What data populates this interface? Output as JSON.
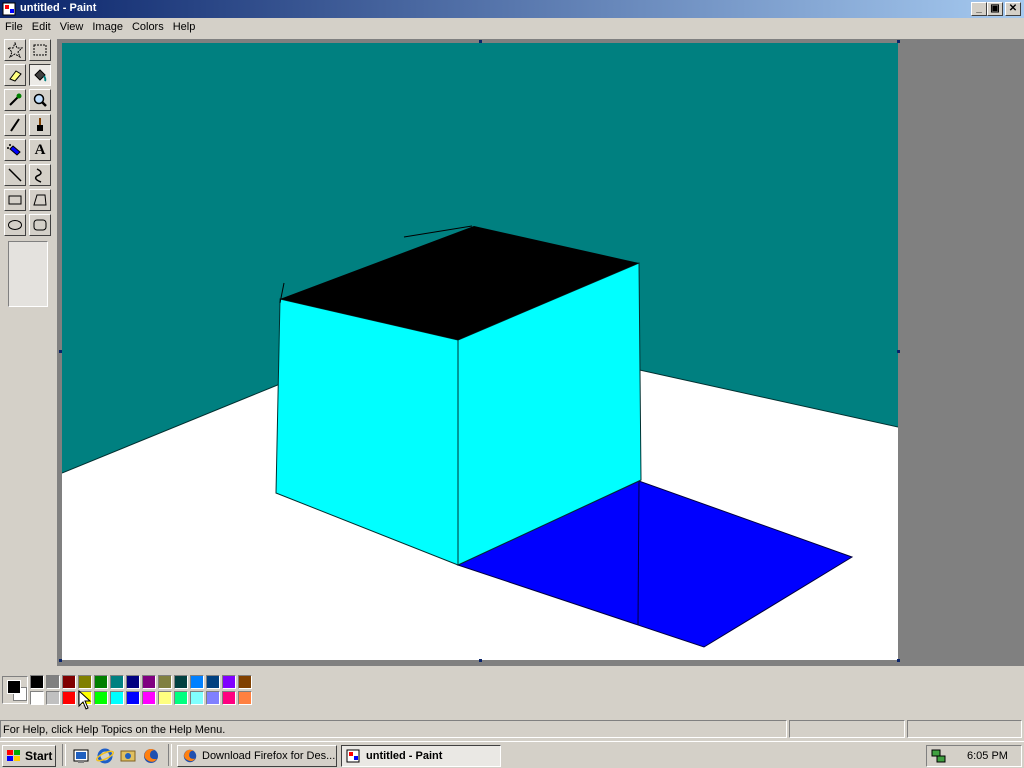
{
  "window": {
    "title": "untitled - Paint",
    "controls": {
      "minimize": "_",
      "maximize": "▣",
      "close": "✕"
    }
  },
  "menubar": {
    "items": [
      {
        "label": "File"
      },
      {
        "label": "Edit"
      },
      {
        "label": "View"
      },
      {
        "label": "Image"
      },
      {
        "label": "Colors"
      },
      {
        "label": "Help"
      }
    ]
  },
  "toolbox": {
    "tools": [
      {
        "name": "free-form-select-tool",
        "icon": "star-select-icon"
      },
      {
        "name": "select-tool",
        "icon": "rect-select-icon"
      },
      {
        "name": "eraser-tool",
        "icon": "eraser-icon"
      },
      {
        "name": "fill-tool",
        "icon": "paint-bucket-icon",
        "selected": true
      },
      {
        "name": "pick-color-tool",
        "icon": "eyedropper-icon"
      },
      {
        "name": "magnifier-tool",
        "icon": "magnifier-icon"
      },
      {
        "name": "pencil-tool",
        "icon": "pencil-icon"
      },
      {
        "name": "brush-tool",
        "icon": "brush-icon"
      },
      {
        "name": "airbrush-tool",
        "icon": "airbrush-icon"
      },
      {
        "name": "text-tool",
        "icon": "text-icon",
        "glyph": "A"
      },
      {
        "name": "line-tool",
        "icon": "line-icon"
      },
      {
        "name": "curve-tool",
        "icon": "curve-icon"
      },
      {
        "name": "rectangle-tool",
        "icon": "rectangle-icon"
      },
      {
        "name": "polygon-tool",
        "icon": "polygon-icon"
      },
      {
        "name": "ellipse-tool",
        "icon": "ellipse-icon"
      },
      {
        "name": "rounded-rectangle-tool",
        "icon": "rounded-rectangle-icon"
      }
    ]
  },
  "colors": {
    "foreground": "#000000",
    "background": "#ffffff",
    "palette_top": [
      "#000000",
      "#808080",
      "#800000",
      "#808000",
      "#008000",
      "#008080",
      "#000080",
      "#800080",
      "#808040",
      "#004040",
      "#0080ff",
      "#004080",
      "#8000ff",
      "#804000"
    ],
    "palette_bottom": [
      "#ffffff",
      "#c0c0c0",
      "#ff0000",
      "#ffff00",
      "#00ff00",
      "#00ffff",
      "#0000ff",
      "#ff00ff",
      "#ffff80",
      "#00ff80",
      "#80ffff",
      "#8080ff",
      "#ff0080",
      "#ff8040"
    ]
  },
  "canvas": {
    "wall_color": "#008080",
    "floor_color": "#ffffff",
    "cube_top_color": "#000000",
    "cube_side_color": "#00ffff",
    "shadow_color": "#0000ff"
  },
  "statusbar": {
    "help_text": "For Help, click Help Topics on the Help Menu."
  },
  "taskbar": {
    "start_label": "Start",
    "quick_launch": [
      "show-desktop-icon",
      "internet-explorer-icon",
      "windows-explorer-icon",
      "firefox-icon"
    ],
    "tasks": [
      {
        "label": "Download Firefox for Des...",
        "icon": "firefox-icon",
        "active": false
      },
      {
        "label": "untitled - Paint",
        "icon": "paint-icon",
        "active": true
      }
    ],
    "clock": "6:05 PM"
  }
}
